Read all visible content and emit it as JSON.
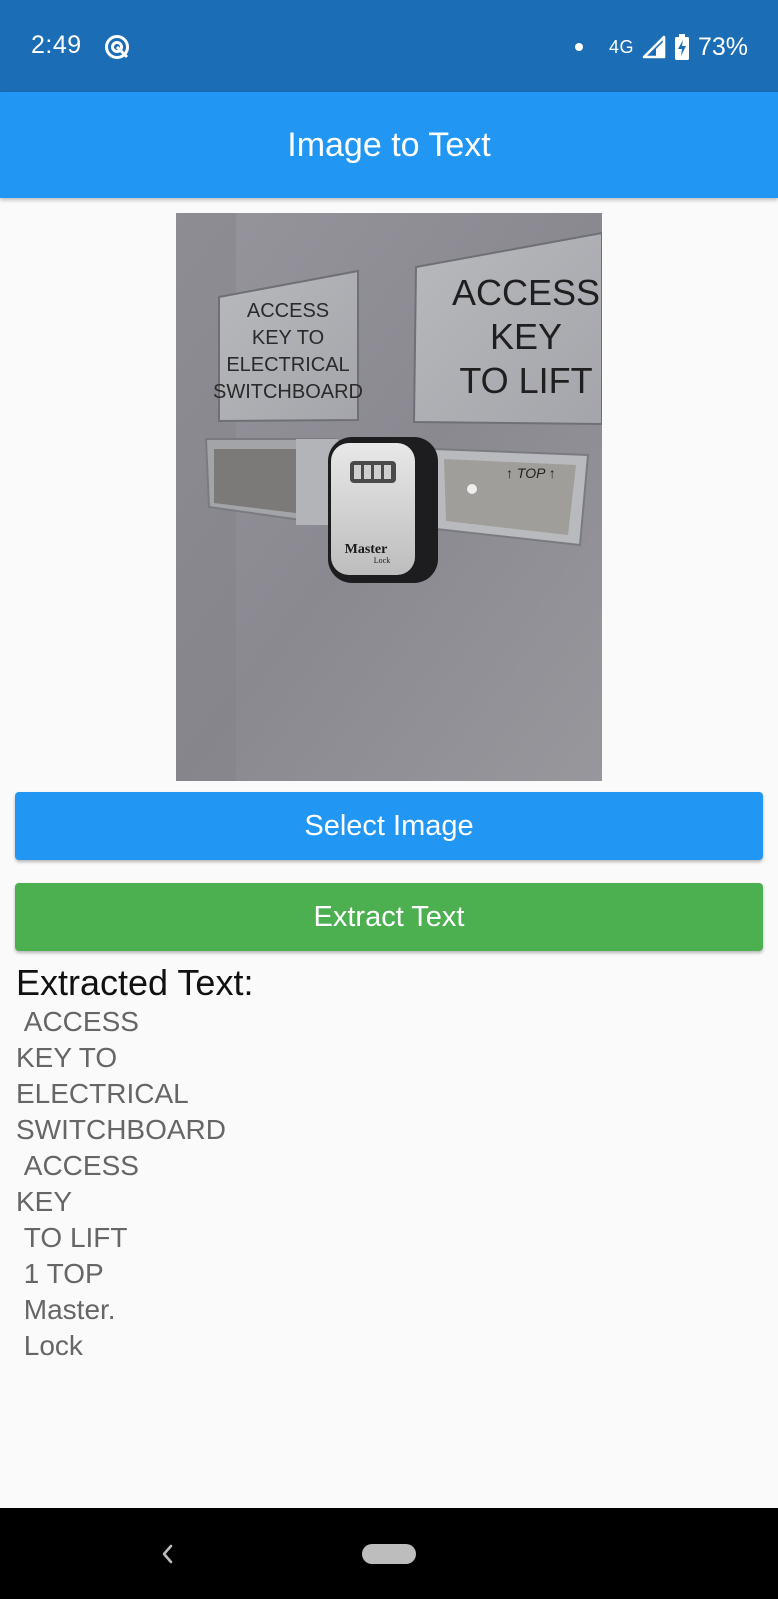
{
  "status_bar": {
    "time": "2:49",
    "network": "4G",
    "battery": "73%"
  },
  "app_bar": {
    "title": "Image to Text"
  },
  "photo": {
    "sign_left_lines": [
      "ACCESS",
      "KEY TO",
      "ELECTRICAL",
      "SWITCHBOARD"
    ],
    "sign_right_lines": [
      "ACCESS",
      "KEY",
      "TO LIFT"
    ],
    "box_label": "↑ TOP ↑",
    "lock_brand": "Master",
    "lock_brand_sub": "Lock"
  },
  "buttons": {
    "select_image": "Select Image",
    "extract_text": "Extract Text"
  },
  "result": {
    "heading": "Extracted Text:",
    "text": " ACCESS\nKEY TO\nELECTRICAL\nSWITCHBOARD\n ACCESS\nKEY\n TO LIFT\n 1 TOP\n Master.\n Lock"
  },
  "colors": {
    "status_bar": "#1b6db5",
    "app_bar": "#2196f3",
    "select_button": "#2196f3",
    "extract_button": "#4caf50",
    "nav_bar": "#000000"
  },
  "icons": [
    "sync-icon",
    "dot-icon",
    "signal-icon",
    "battery-charging-icon",
    "back-icon",
    "home-pill-icon"
  ]
}
